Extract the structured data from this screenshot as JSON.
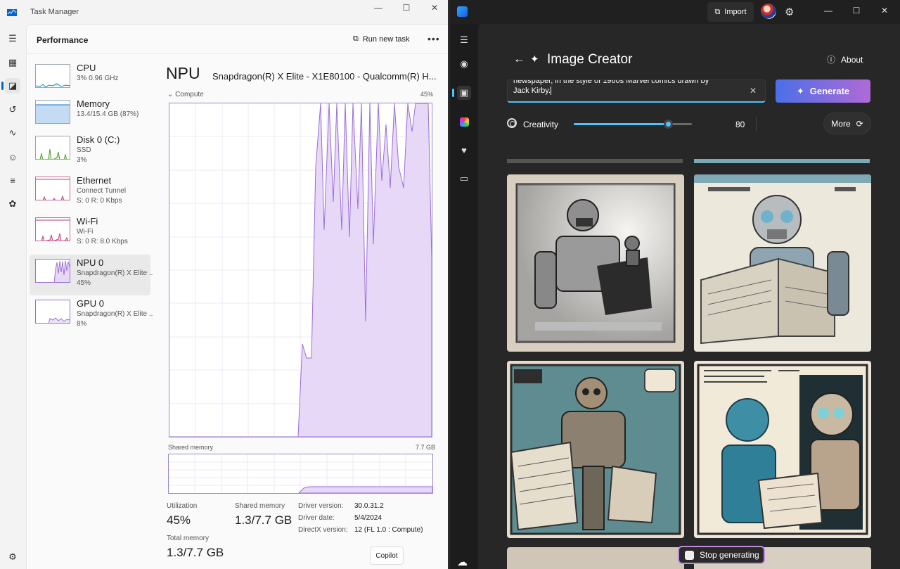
{
  "task_manager": {
    "window_title": "Task Manager",
    "header": {
      "title": "Performance",
      "run_task_label": "Run new task",
      "more_label": "•••"
    },
    "items": [
      {
        "name": "CPU",
        "sub": "3%  0.96 GHz",
        "sub2": ""
      },
      {
        "name": "Memory",
        "sub": "13.4/15.4 GB (87%)",
        "sub2": ""
      },
      {
        "name": "Disk 0 (C:)",
        "sub": "SSD",
        "sub2": "3%"
      },
      {
        "name": "Ethernet",
        "sub": "Connect Tunnel",
        "sub2": "S: 0  R: 0 Kbps"
      },
      {
        "name": "Wi-Fi",
        "sub": "Wi-Fi",
        "sub2": "S: 0  R: 8.0 Kbps"
      },
      {
        "name": "NPU 0",
        "sub": "Snapdragon(R) X Elite ...",
        "sub2": "45%"
      },
      {
        "name": "GPU 0",
        "sub": "Snapdragon(R) X Elite ...",
        "sub2": "8%"
      }
    ],
    "detail": {
      "title": "NPU",
      "device": "Snapdragon(R) X Elite - X1E80100 - Qualcomm(R) H...",
      "compute_label": "Compute",
      "compute_max": "45%",
      "shared_memory_label": "Shared memory",
      "shared_memory_max": "7.7 GB",
      "utilization_label": "Utilization",
      "utilization_value": "45%",
      "shared_label": "Shared memory",
      "shared_value": "1.3/7.7 GB",
      "total_label": "Total memory",
      "total_value": "1.3/7.7 GB",
      "driver_version_label": "Driver version:",
      "driver_version": "30.0.31.2",
      "driver_date_label": "Driver date:",
      "driver_date": "5/4/2024",
      "directx_label": "DirectX version:",
      "directx": "12 (FL 1.0 : Compute)"
    },
    "copilot_label": "Copilot"
  },
  "image_creator": {
    "import_label": "Import",
    "title": "Image Creator",
    "about_label": "About",
    "prompt_line1": "newspaper, in the style of 1960s Marvel comics drawn by",
    "prompt_line2": "Jack Kirby.",
    "generate_label": "Generate",
    "creativity_label": "Creativity",
    "creativity_value": "80",
    "creativity_fraction": 0.8,
    "more_label": "More",
    "stop_label": "Stop generating"
  },
  "colors": {
    "npu_line": "#9b6fd6",
    "npu_fill": "#e7d8f7",
    "accent": "#4cc2ff"
  }
}
